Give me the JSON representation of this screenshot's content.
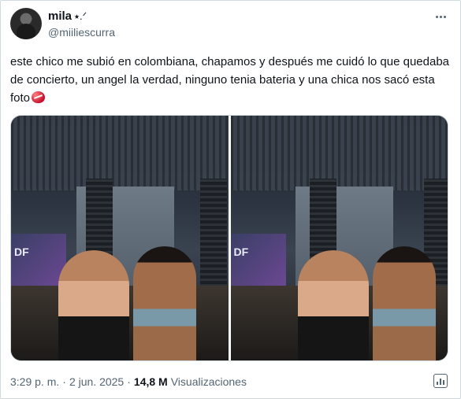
{
  "author": {
    "display_name": "mila",
    "name_decoration": "⭑.ᐟ",
    "handle": "@miiliescurra"
  },
  "tweet": {
    "text": "este chico me subió en colombiana, chapamos y después me cuidó lo que quedaba de concierto, un angel la verdad, ninguno tenia bateria y una chica nos sacó esta foto",
    "emoji_icon": "heart-bandage-icon"
  },
  "media": {
    "photos": [
      {
        "screen_text": "DF"
      },
      {
        "screen_text": "DF"
      }
    ]
  },
  "meta": {
    "time": "3:29 p. m.",
    "separator1": "·",
    "date": "2 jun. 2025",
    "separator2": "·",
    "views_count": "14,8 M",
    "views_label": "Visualizaciones"
  },
  "colors": {
    "text": "#0f1419",
    "secondary": "#536471",
    "border": "#cfd9de"
  }
}
